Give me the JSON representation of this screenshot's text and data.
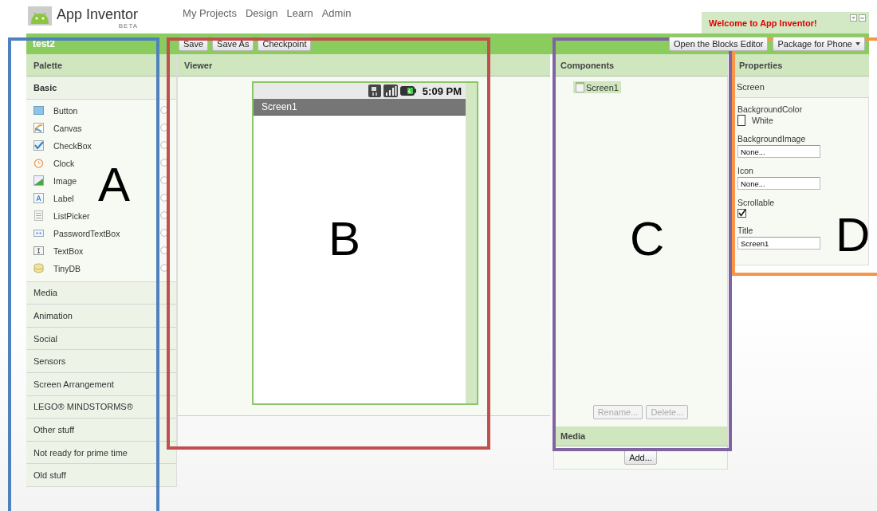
{
  "header": {
    "app_name": "App Inventor",
    "badge": "BETA",
    "nav": [
      "My Projects",
      "Design",
      "Learn",
      "Admin"
    ]
  },
  "welcome": {
    "message": "Welcome to App Inventor!"
  },
  "project": {
    "name": "test2",
    "left_buttons": [
      "Save",
      "Save As",
      "Checkpoint"
    ],
    "right_buttons": [
      {
        "label": "Open the Blocks Editor",
        "dropdown": false
      },
      {
        "label": "Package for Phone",
        "dropdown": true
      }
    ]
  },
  "palette": {
    "title": "Palette",
    "categories": [
      {
        "label": "Basic",
        "expanded": true,
        "items": [
          "Button",
          "Canvas",
          "CheckBox",
          "Clock",
          "Image",
          "Label",
          "ListPicker",
          "PasswordTextBox",
          "TextBox",
          "TinyDB"
        ]
      },
      {
        "label": "Media",
        "expanded": false
      },
      {
        "label": "Animation",
        "expanded": false
      },
      {
        "label": "Social",
        "expanded": false
      },
      {
        "label": "Sensors",
        "expanded": false
      },
      {
        "label": "Screen Arrangement",
        "expanded": false
      },
      {
        "label": "LEGO® MINDSTORMS®",
        "expanded": false
      },
      {
        "label": "Other stuff",
        "expanded": false
      },
      {
        "label": "Not ready for prime time",
        "expanded": false
      },
      {
        "label": "Old stuff",
        "expanded": false
      }
    ]
  },
  "viewer": {
    "title": "Viewer",
    "phone": {
      "time": "5:09 PM",
      "screen_title": "Screen1"
    }
  },
  "components": {
    "title": "Components",
    "tree": [
      {
        "label": "Screen1",
        "selected": true
      }
    ],
    "buttons": [
      {
        "label": "Rename...",
        "disabled": true
      },
      {
        "label": "Delete...",
        "disabled": true
      }
    ],
    "media_title": "Media",
    "media_buttons": [
      {
        "label": "Add...",
        "disabled": false
      }
    ]
  },
  "properties": {
    "title": "Properties",
    "component": "Screen",
    "items": [
      {
        "kind": "color",
        "label": "BackgroundColor",
        "value": "White"
      },
      {
        "kind": "field",
        "label": "BackgroundImage",
        "value": "None..."
      },
      {
        "kind": "field",
        "label": "Icon",
        "value": "None..."
      },
      {
        "kind": "checkbox",
        "label": "Scrollable",
        "checked": true
      },
      {
        "kind": "field",
        "label": "Title",
        "value": "Screen1"
      }
    ]
  },
  "annotations": [
    {
      "letter": "A",
      "color": "#4f81bd"
    },
    {
      "letter": "B",
      "color": "#c0504d"
    },
    {
      "letter": "C",
      "color": "#8064a2"
    },
    {
      "letter": "D",
      "color": "#f79646"
    }
  ]
}
